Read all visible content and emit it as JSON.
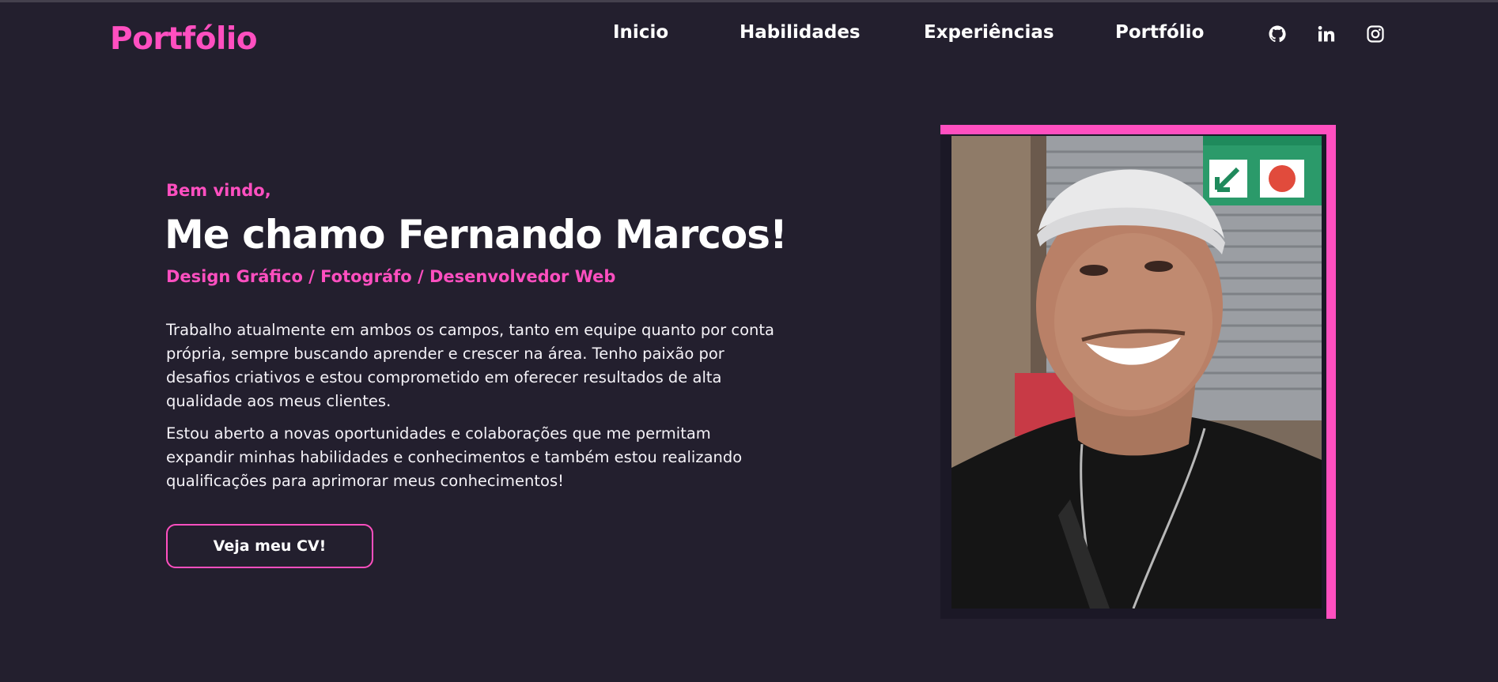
{
  "header": {
    "logo": "Portfólio",
    "nav": [
      "Inicio",
      "Habilidades",
      "Experiências",
      "Portfólio"
    ],
    "social_icons": [
      "github-icon",
      "linkedin-icon",
      "instagram-icon"
    ]
  },
  "hero": {
    "greeting": "Bem vindo,",
    "headline": "Me chamo Fernando Marcos!",
    "roles": "Design Gráfico / Fotográfo / Desenvolvedor Web",
    "paragraphs": [
      "Trabalho atualmente em ambos os campos, tanto em equipe quanto por conta própria, sempre buscando aprender e crescer na área. Tenho paixão por desafios criativos e estou comprometido em oferecer resultados de alta qualidade aos meus clientes.",
      "Estou aberto a novas oportunidades e colaborações que me permitam expandir minhas habilidades e conhecimentos e também estou realizando qualificações para aprimorar meus conhecimentos!"
    ],
    "cv_button": "Veja meu CV!"
  },
  "colors": {
    "background": "#231f2e",
    "accent": "#ff4fc0",
    "text": "#ffffff"
  }
}
